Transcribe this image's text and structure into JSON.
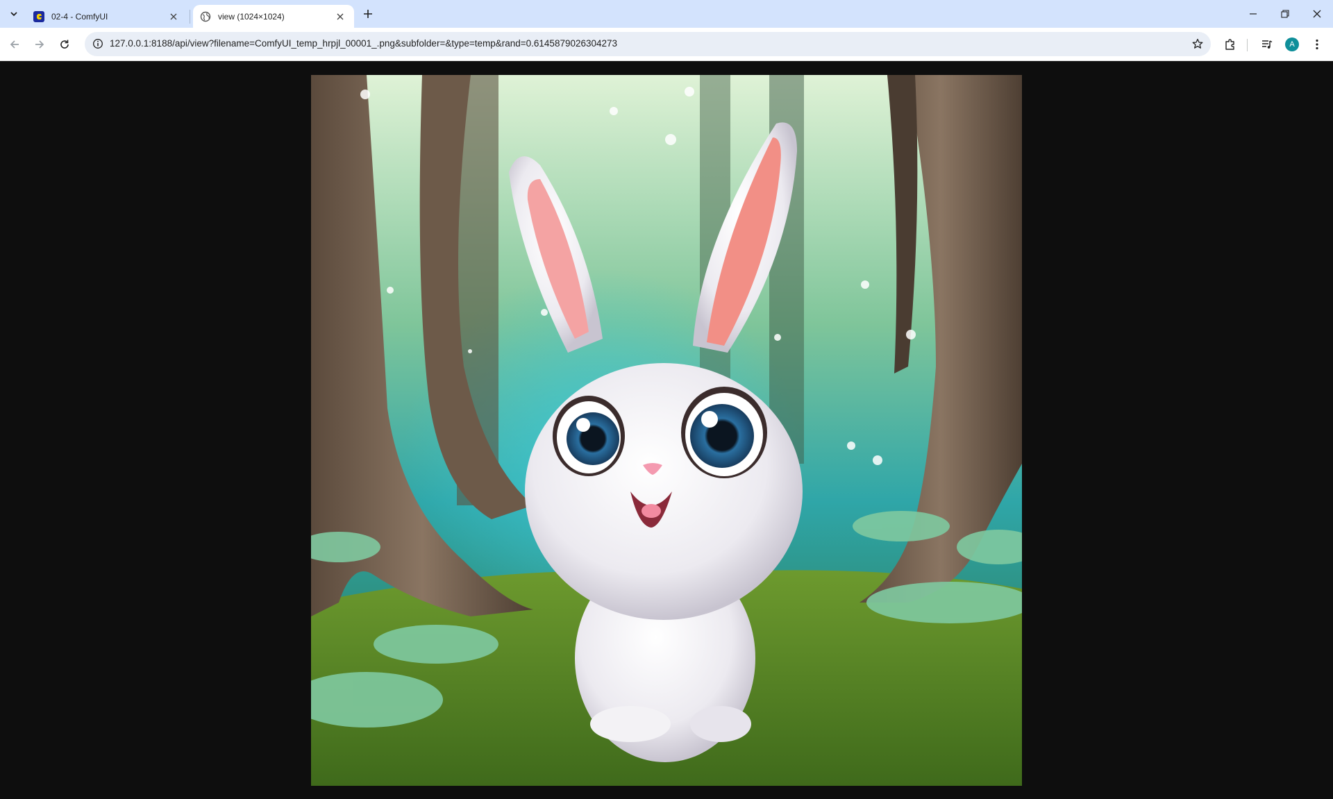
{
  "tabs": [
    {
      "title": "02-4 - ComfyUI",
      "active": false,
      "favicon": "comfyui-logo-icon"
    },
    {
      "title": "view (1024×1024)",
      "active": true,
      "favicon": "globe-icon"
    }
  ],
  "address_bar": {
    "url": "127.0.0.1:8188/api/view?filename=ComfyUI_temp_hrpjl_00001_.png&subfolder=&type=temp&rand=0.6145879026304273"
  },
  "profile": {
    "initial": "A",
    "color": "#0f8f9a"
  },
  "colors": {
    "tabstrip": "#d3e3fd",
    "page_background": "#0e0e0e",
    "omnibox": "#e9eef6"
  }
}
